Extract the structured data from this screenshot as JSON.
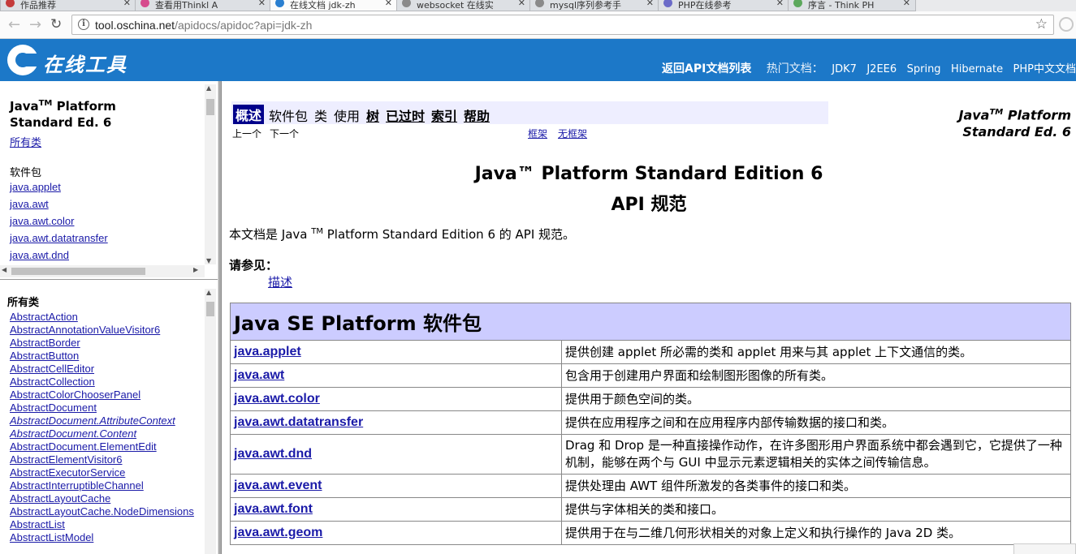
{
  "browser": {
    "tabs": [
      {
        "label": "作品推荐",
        "color": "#c43b3b",
        "active": false
      },
      {
        "label": "查看用Thinkl A",
        "color": "#d64a8d",
        "active": false
      },
      {
        "label": "在线文档 jdk-zh",
        "color": "#2a7fd0",
        "active": true
      },
      {
        "label": "websocket 在线实",
        "color": "#8a8a8a",
        "active": false
      },
      {
        "label": "mysql序列参考手",
        "color": "#8a8a8a",
        "active": false
      },
      {
        "label": "PHP在线参考",
        "color": "#6b6bc8",
        "active": false
      },
      {
        "label": "序言 - Think PH",
        "color": "#5ca85c",
        "active": false
      }
    ],
    "url_host": "tool.oschina.net",
    "url_path": "/apidocs/apidoc?api=jdk-zh"
  },
  "site": {
    "logo_text": "在线工具",
    "back_link": "返回API文档列表",
    "hot_label": "热门文档：",
    "hot_links": [
      "JDK7",
      "J2EE6",
      "Spring",
      "Hibernate",
      "PHP中文文档"
    ]
  },
  "left_top": {
    "title_a": "Java",
    "title_tm": "TM",
    "title_b": " Platform",
    "title_c": "Standard Ed. 6",
    "all_classes": "所有类",
    "packages_label": "软件包",
    "packages": [
      "java.applet",
      "java.awt",
      "java.awt.color",
      "java.awt.datatransfer",
      "java.awt.dnd"
    ]
  },
  "left_bottom": {
    "heading": "所有类",
    "classes": [
      {
        "name": "AbstractAction",
        "italic": false
      },
      {
        "name": "AbstractAnnotationValueVisitor6",
        "italic": false
      },
      {
        "name": "AbstractBorder",
        "italic": false
      },
      {
        "name": "AbstractButton",
        "italic": false
      },
      {
        "name": "AbstractCellEditor",
        "italic": false
      },
      {
        "name": "AbstractCollection",
        "italic": false
      },
      {
        "name": "AbstractColorChooserPanel",
        "italic": false
      },
      {
        "name": "AbstractDocument",
        "italic": false
      },
      {
        "name": "AbstractDocument.AttributeContext",
        "italic": true
      },
      {
        "name": "AbstractDocument.Content",
        "italic": true
      },
      {
        "name": "AbstractDocument.ElementEdit",
        "italic": false
      },
      {
        "name": "AbstractElementVisitor6",
        "italic": false
      },
      {
        "name": "AbstractExecutorService",
        "italic": false
      },
      {
        "name": "AbstractInterruptibleChannel",
        "italic": false
      },
      {
        "name": "AbstractLayoutCache",
        "italic": false
      },
      {
        "name": "AbstractLayoutCache.NodeDimensions",
        "italic": false
      },
      {
        "name": "AbstractList",
        "italic": false
      },
      {
        "name": "AbstractListModel",
        "italic": false
      }
    ]
  },
  "main": {
    "nav": {
      "overview": "概述",
      "package": "软件包",
      "class": "类",
      "use": "使用",
      "tree": "树",
      "deprecated": "已过时",
      "index": "索引",
      "help": "帮助"
    },
    "prev": "上一个",
    "next": "下一个",
    "frames": "框架",
    "no_frames": "无框架",
    "side_title_a": "Java",
    "side_title_tm": "TM",
    "side_title_b": " Platform",
    "side_title_c": "Standard Ed. 6",
    "heading1": "Java™ Platform Standard Edition 6",
    "heading2": "API 规范",
    "intro_a": "本文档是 Java ",
    "intro_tm": "TM",
    "intro_b": " Platform Standard Edition 6 的 API 规范。",
    "see_also": "请参见：",
    "description_link": "描述",
    "table_title": "Java SE Platform 软件包",
    "packages": [
      {
        "name": "java.applet",
        "desc": "提供创建 applet 所必需的类和 applet 用来与其 applet 上下文通信的类。"
      },
      {
        "name": "java.awt",
        "desc": "包含用于创建用户界面和绘制图形图像的所有类。"
      },
      {
        "name": "java.awt.color",
        "desc": "提供用于颜色空间的类。"
      },
      {
        "name": "java.awt.datatransfer",
        "desc": "提供在应用程序之间和在应用程序内部传输数据的接口和类。"
      },
      {
        "name": "java.awt.dnd",
        "desc": "Drag 和 Drop 是一种直接操作动作，在许多图形用户界面系统中都会遇到它，它提供了一种机制，能够在两个与 GUI 中显示元素逻辑相关的实体之间传输信息。"
      },
      {
        "name": "java.awt.event",
        "desc": "提供处理由 AWT 组件所激发的各类事件的接口和类。"
      },
      {
        "name": "java.awt.font",
        "desc": "提供与字体相关的类和接口。"
      },
      {
        "name": "java.awt.geom",
        "desc": "提供用于在与二维几何形状相关的对象上定义和执行操作的 Java 2D 类。"
      }
    ]
  }
}
